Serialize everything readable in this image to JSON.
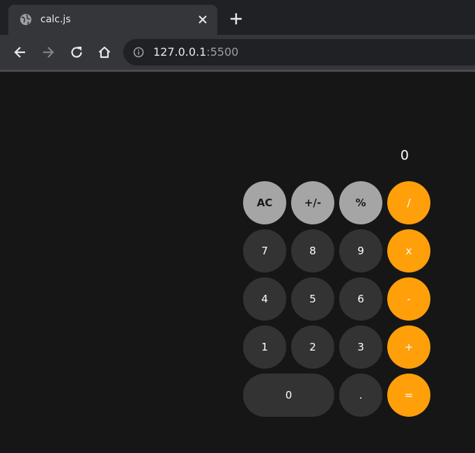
{
  "browser": {
    "tab": {
      "title": "calc.js",
      "favicon_icon": "globe-icon",
      "close_icon": "close-icon"
    },
    "new_tab_icon": "plus-icon",
    "toolbar": {
      "back_icon": "back-arrow-icon",
      "forward_icon": "forward-arrow-icon",
      "reload_icon": "reload-icon",
      "home_icon": "home-icon",
      "info_icon": "info-icon"
    },
    "url": {
      "host": "127.0.0.1",
      "port": ":5500"
    }
  },
  "calculator": {
    "display": "0",
    "keys": [
      {
        "label": "AC",
        "kind": "fn"
      },
      {
        "label": "+/-",
        "kind": "fn"
      },
      {
        "label": "%",
        "kind": "fn"
      },
      {
        "label": "/",
        "kind": "op"
      },
      {
        "label": "7",
        "kind": "num"
      },
      {
        "label": "8",
        "kind": "num"
      },
      {
        "label": "9",
        "kind": "num"
      },
      {
        "label": "x",
        "kind": "op"
      },
      {
        "label": "4",
        "kind": "num"
      },
      {
        "label": "5",
        "kind": "num"
      },
      {
        "label": "6",
        "kind": "num"
      },
      {
        "label": "-",
        "kind": "op"
      },
      {
        "label": "1",
        "kind": "num"
      },
      {
        "label": "2",
        "kind": "num"
      },
      {
        "label": "3",
        "kind": "num"
      },
      {
        "label": "+",
        "kind": "op"
      },
      {
        "label": "0",
        "kind": "num"
      },
      {
        "label": ".",
        "kind": "num"
      },
      {
        "label": "=",
        "kind": "op"
      }
    ]
  },
  "colors": {
    "page_background": "#161616",
    "function_key": "#a5a5a5",
    "number_key": "#333333",
    "operator_key": "#ff9f0a"
  }
}
